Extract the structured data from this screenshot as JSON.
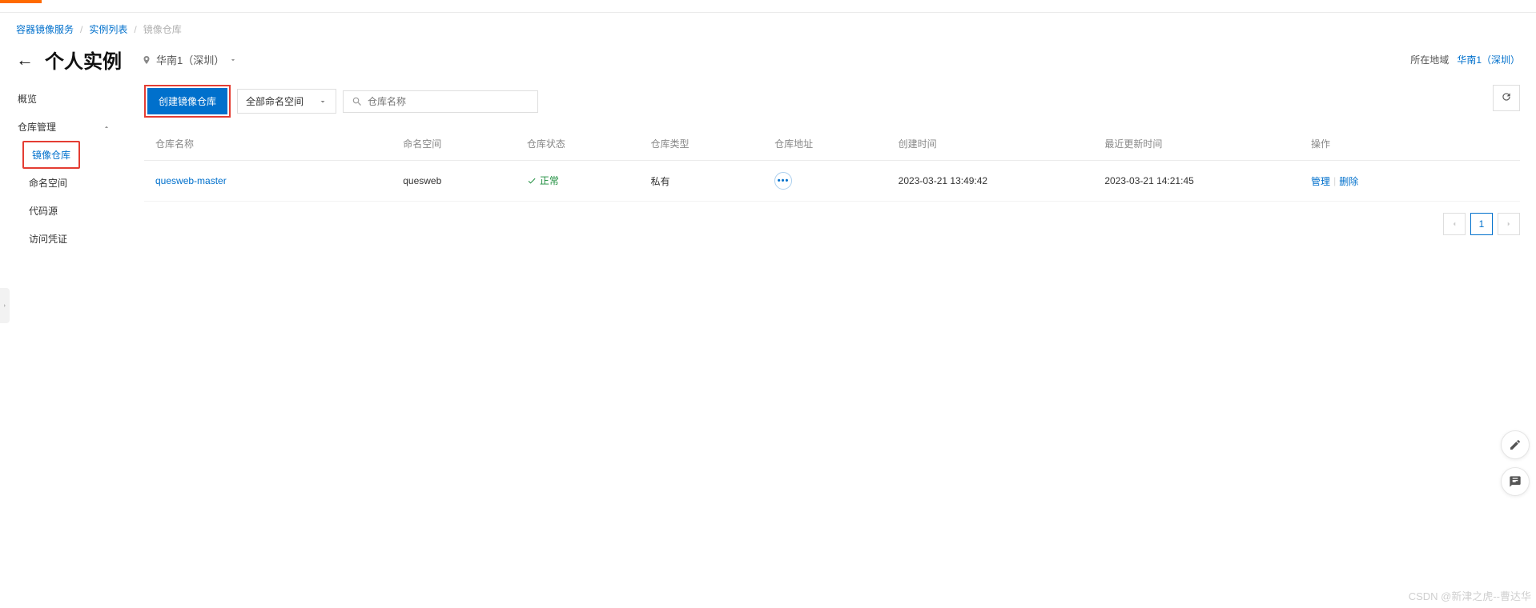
{
  "breadcrumb": {
    "item1": "容器镜像服务",
    "item2": "实例列表",
    "item3": "镜像仓库"
  },
  "header": {
    "title": "个人实例",
    "region": "华南1（深圳）",
    "region_label": "所在地域",
    "region_value": "华南1（深圳）"
  },
  "sidebar": {
    "overview": "概览",
    "repo_mgmt": "仓库管理",
    "image_repo": "镜像仓库",
    "namespace": "命名空间",
    "code_source": "代码源",
    "access_cred": "访问凭证"
  },
  "toolbar": {
    "create_btn": "创建镜像仓库",
    "namespace_filter": "全部命名空间",
    "search_placeholder": "仓库名称"
  },
  "table": {
    "headers": {
      "name": "仓库名称",
      "ns": "命名空间",
      "status": "仓库状态",
      "type": "仓库类型",
      "addr": "仓库地址",
      "created": "创建时间",
      "updated": "最近更新时间",
      "ops": "操作"
    },
    "rows": [
      {
        "name": "quesweb-master",
        "ns": "quesweb",
        "status": "正常",
        "type": "私有",
        "created": "2023-03-21 13:49:42",
        "updated": "2023-03-21 14:21:45",
        "op_manage": "管理",
        "op_delete": "删除"
      }
    ]
  },
  "pagination": {
    "page1": "1"
  },
  "watermark": "CSDN @新津之虎--曹达华"
}
